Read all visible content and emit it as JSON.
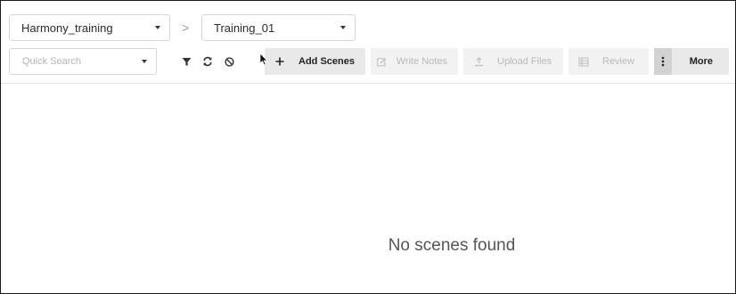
{
  "project_select": {
    "value": "Harmony_training"
  },
  "episode_select": {
    "value": "Training_01"
  },
  "breadcrumb_separator": ">",
  "search": {
    "placeholder": "Quick Search"
  },
  "toolbar": {
    "icons": [
      "filter-icon",
      "refresh-icon",
      "clear-icon"
    ],
    "add_scenes_label": "Add Scenes",
    "write_notes_label": "Write Notes",
    "upload_files_label": "Upload Files",
    "review_label": "Review",
    "more_label": "More"
  },
  "main": {
    "empty_message": "No scenes found"
  }
}
